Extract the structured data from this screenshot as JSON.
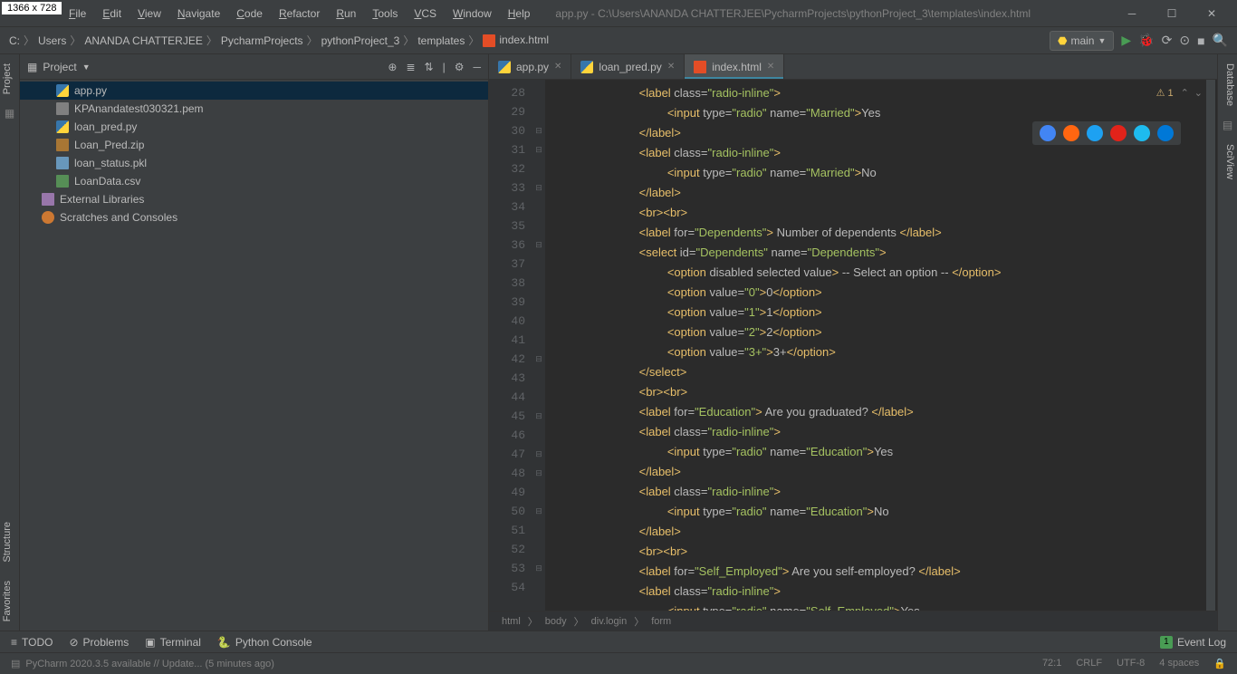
{
  "dim_badge": "1366 x 728",
  "menus": [
    "File",
    "Edit",
    "View",
    "Navigate",
    "Code",
    "Refactor",
    "Run",
    "Tools",
    "VCS",
    "Window",
    "Help"
  ],
  "title_path": "app.py - C:\\Users\\ANANDA CHATTERJEE\\PycharmProjects\\pythonProject_3\\templates\\index.html",
  "breadcrumbs": [
    "C:",
    "Users",
    "ANANDA CHATTERJEE",
    "PycharmProjects",
    "pythonProject_3",
    "templates",
    "index.html"
  ],
  "run_config": "main",
  "project_label": "Project",
  "project_tree": [
    {
      "name": "app.py",
      "icon": "fi-py",
      "selected": true
    },
    {
      "name": "KPAnandatest030321.pem",
      "icon": "fi-file"
    },
    {
      "name": "loan_pred.py",
      "icon": "fi-py"
    },
    {
      "name": "Loan_Pred.zip",
      "icon": "fi-zip"
    },
    {
      "name": "loan_status.pkl",
      "icon": "fi-pkl"
    },
    {
      "name": "LoanData.csv",
      "icon": "fi-csv"
    }
  ],
  "tree_libs": [
    {
      "name": "External Libraries",
      "icon": "fi-lib"
    },
    {
      "name": "Scratches and Consoles",
      "icon": "fi-scratch"
    }
  ],
  "tabs": [
    {
      "label": "app.py",
      "icon": "fi-py",
      "active": false
    },
    {
      "label": "loan_pred.py",
      "icon": "fi-py",
      "active": false
    },
    {
      "label": "index.html",
      "icon": "fi-html",
      "active": true
    }
  ],
  "line_start": 28,
  "line_end": 54,
  "code_lines": [
    {
      "n": 28,
      "fold": "",
      "html": "            <span class='k-tag'>&lt;label </span><span class='k-attr'>class=</span><span class='k-str'>\"radio-inline\"</span><span class='k-tag'>&gt;</span>"
    },
    {
      "n": 29,
      "fold": "",
      "html": "                <span class='k-tag'>&lt;input </span><span class='k-attr'>type=</span><span class='k-str'>\"radio\"</span><span class='k-attr'> name=</span><span class='k-str'>\"Married\"</span><span class='k-tag'>&gt;</span><span class='k-txt'>Yes</span>"
    },
    {
      "n": 30,
      "fold": "⊟",
      "html": "            <span class='k-tag'>&lt;/label&gt;</span>"
    },
    {
      "n": 31,
      "fold": "⊟",
      "html": "            <span class='k-tag'>&lt;label </span><span class='k-attr'>class=</span><span class='k-str'>\"radio-inline\"</span><span class='k-tag'>&gt;</span>"
    },
    {
      "n": 32,
      "fold": "",
      "html": "                <span class='k-tag'>&lt;input </span><span class='k-attr'>type=</span><span class='k-str'>\"radio\"</span><span class='k-attr'> name=</span><span class='k-str'>\"Married\"</span><span class='k-tag'>&gt;</span><span class='k-txt'>No</span>"
    },
    {
      "n": 33,
      "fold": "⊟",
      "html": "            <span class='k-tag'>&lt;/label&gt;</span>"
    },
    {
      "n": 34,
      "fold": "",
      "html": "            <span class='k-tag'>&lt;br&gt;&lt;br&gt;</span>"
    },
    {
      "n": 35,
      "fold": "",
      "html": "            <span class='k-tag'>&lt;label </span><span class='k-attr'>for=</span><span class='k-str'>\"Dependents\"</span><span class='k-tag'>&gt;</span><span class='k-txt'> Number of dependents </span><span class='k-tag'>&lt;/label&gt;</span>"
    },
    {
      "n": 36,
      "fold": "⊟",
      "html": "            <span class='k-tag'>&lt;select </span><span class='k-attr'>id=</span><span class='k-str'>\"Dependents\"</span><span class='k-attr'> name=</span><span class='k-str'>\"Dependents\"</span><span class='k-tag'>&gt;</span>"
    },
    {
      "n": 37,
      "fold": "",
      "html": "                <span class='k-tag'>&lt;option </span><span class='k-attr'>disabled selected value</span><span class='k-tag'>&gt;</span><span class='k-txt'> -- Select an option -- </span><span class='k-tag'>&lt;/option&gt;</span>"
    },
    {
      "n": 38,
      "fold": "",
      "html": "                <span class='k-tag'>&lt;option </span><span class='k-attr'>value=</span><span class='k-str'>\"0\"</span><span class='k-tag'>&gt;</span><span class='k-txt'>0</span><span class='k-tag'>&lt;/option&gt;</span>"
    },
    {
      "n": 39,
      "fold": "",
      "html": "                <span class='k-tag'>&lt;option </span><span class='k-attr'>value=</span><span class='k-str'>\"1\"</span><span class='k-tag'>&gt;</span><span class='k-txt'>1</span><span class='k-tag'>&lt;/option&gt;</span>"
    },
    {
      "n": 40,
      "fold": "",
      "html": "                <span class='k-tag'>&lt;option </span><span class='k-attr'>value=</span><span class='k-str'>\"2\"</span><span class='k-tag'>&gt;</span><span class='k-txt'>2</span><span class='k-tag'>&lt;/option&gt;</span>"
    },
    {
      "n": 41,
      "fold": "",
      "html": "                <span class='k-tag'>&lt;option </span><span class='k-attr'>value=</span><span class='k-str'>\"3+\"</span><span class='k-tag'>&gt;</span><span class='k-txt'>3+</span><span class='k-tag'>&lt;/option&gt;</span>"
    },
    {
      "n": 42,
      "fold": "⊟",
      "html": "            <span class='k-tag'>&lt;/select&gt;</span>"
    },
    {
      "n": 43,
      "fold": "",
      "html": "            <span class='k-tag'>&lt;br&gt;&lt;br&gt;</span>"
    },
    {
      "n": 44,
      "fold": "",
      "html": "            <span class='k-tag'>&lt;label </span><span class='k-attr'>for=</span><span class='k-str'>\"Education\"</span><span class='k-tag'>&gt;</span><span class='k-txt'> Are you graduated? </span><span class='k-tag'>&lt;/label&gt;</span>"
    },
    {
      "n": 45,
      "fold": "⊟",
      "html": "            <span class='k-tag'>&lt;label </span><span class='k-attr'>class=</span><span class='k-str'>\"radio-inline\"</span><span class='k-tag'>&gt;</span>"
    },
    {
      "n": 46,
      "fold": "",
      "html": "                <span class='k-tag'>&lt;input </span><span class='k-attr'>type=</span><span class='k-str'>\"radio\"</span><span class='k-attr'> name=</span><span class='k-str'>\"Education\"</span><span class='k-tag'>&gt;</span><span class='k-txt'>Yes</span>"
    },
    {
      "n": 47,
      "fold": "⊟",
      "html": "            <span class='k-tag'>&lt;/label&gt;</span>"
    },
    {
      "n": 48,
      "fold": "⊟",
      "html": "            <span class='k-tag'>&lt;label </span><span class='k-attr'>class=</span><span class='k-str'>\"radio-inline\"</span><span class='k-tag'>&gt;</span>"
    },
    {
      "n": 49,
      "fold": "",
      "html": "                <span class='k-tag'>&lt;input </span><span class='k-attr'>type=</span><span class='k-str'>\"radio\"</span><span class='k-attr'> name=</span><span class='k-str'>\"Education\"</span><span class='k-tag'>&gt;</span><span class='k-txt'>No</span>"
    },
    {
      "n": 50,
      "fold": "⊟",
      "html": "            <span class='k-tag'>&lt;/label&gt;</span>"
    },
    {
      "n": 51,
      "fold": "",
      "html": "            <span class='k-tag'>&lt;br&gt;&lt;br&gt;</span>"
    },
    {
      "n": 52,
      "fold": "",
      "html": "            <span class='k-tag'>&lt;label </span><span class='k-attr'>for=</span><span class='k-str'>\"Self_Employed\"</span><span class='k-tag'>&gt;</span><span class='k-txt'> Are you self-employed? </span><span class='k-tag'>&lt;/label&gt;</span>"
    },
    {
      "n": 53,
      "fold": "⊟",
      "html": "            <span class='k-tag'>&lt;label </span><span class='k-attr'>class=</span><span class='k-str'>\"radio-inline\"</span><span class='k-tag'>&gt;</span>"
    },
    {
      "n": 54,
      "fold": "",
      "html": "                <span class='k-tag'>&lt;input </span><span class='k-attr'>type=</span><span class='k-str'>\"radio\"</span><span class='k-attr'> name=</span><span class='k-str'>\"Self_Employed\"</span><span class='k-tag'>&gt;</span><span class='k-txt'>Yes</span>"
    }
  ],
  "editor_crumbs": [
    "html",
    "body",
    "div.login",
    "form"
  ],
  "inspection_count": "1",
  "bottom_tools": [
    {
      "icon": "≡",
      "label": "TODO"
    },
    {
      "icon": "⊘",
      "label": "Problems"
    },
    {
      "icon": "▣",
      "label": "Terminal"
    },
    {
      "icon": "🐍",
      "label": "Python Console"
    }
  ],
  "event_log": "Event Log",
  "status_msg": "PyCharm 2020.3.5 available // Update... (5 minutes ago)",
  "status_right": [
    "72:1",
    "CRLF",
    "UTF-8",
    "4 spaces",
    "🔒"
  ],
  "left_tabs": [
    "Project"
  ],
  "left_bottom_tabs": [
    "Structure",
    "Favorites"
  ],
  "right_tabs": [
    "Database",
    "SciView"
  ],
  "browser_colors": [
    "#4285f4",
    "#ff6611",
    "#1da1f2",
    "#e2231a",
    "#1ebbee",
    "#0078d7"
  ]
}
